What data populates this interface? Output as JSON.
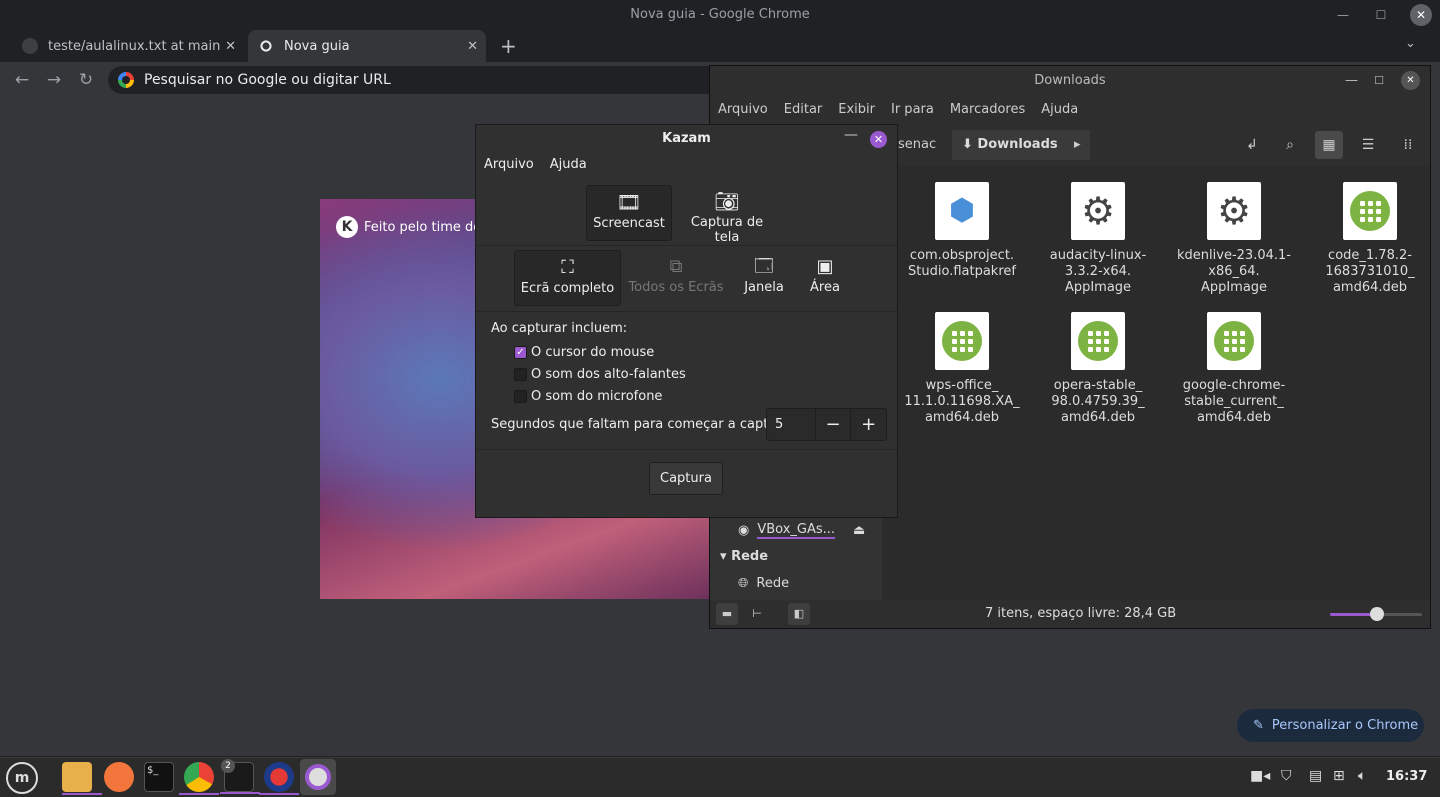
{
  "chrome": {
    "window_title": "Nova guia - Google Chrome",
    "tabs": [
      {
        "label": "teste/aulalinux.txt at main · ar",
        "icon": "github-icon"
      },
      {
        "label": "Nova guia",
        "icon": "chrome-icon"
      }
    ],
    "omnibox_placeholder": "Pesquisar no Google ou digitar URL",
    "kde_credit": "Feito pelo time do",
    "personalize_label": "Personalizar o Chrome"
  },
  "nemo": {
    "title": "Downloads",
    "menu": [
      "Arquivo",
      "Editar",
      "Exibir",
      "Ir para",
      "Marcadores",
      "Ajuda"
    ],
    "breadcrumb_prev": "senac",
    "breadcrumb_current": "Downloads",
    "files": [
      {
        "name": "com.obsproject.\nStudio.flatpakref",
        "icon": "flatpak-icon"
      },
      {
        "name": "audacity-linux-\n3.3.2-x64.\nAppImage",
        "icon": "gear-icon"
      },
      {
        "name": "kdenlive-23.04.1-\nx86_64.\nAppImage",
        "icon": "gear-icon"
      },
      {
        "name": "code_1.78.2-\n1683731010_\namd64.deb",
        "icon": "deb-icon"
      },
      {
        "name": "wps-office_\n11.1.0.11698.XA_\namd64.deb",
        "icon": "deb-icon"
      },
      {
        "name": "opera-stable_\n98.0.4759.39_\namd64.deb",
        "icon": "deb-icon"
      },
      {
        "name": "google-chrome-\nstable_current_\namd64.deb",
        "icon": "deb-icon"
      }
    ],
    "sidebar": {
      "device": "VBox_GAs...",
      "network_header": "Rede",
      "network_item": "Rede"
    },
    "status": "7 itens, espaço livre: 28,4 GB",
    "zoom_level": 0.5
  },
  "kazam": {
    "title": "Kazam",
    "menu": [
      "Arquivo",
      "Ajuda"
    ],
    "modes": [
      "Screencast",
      "Captura de tela"
    ],
    "sources": [
      "Ecrã completo",
      "Todos os Ecrãs",
      "Janela",
      "Área"
    ],
    "include_label": "Ao capturar incluem:",
    "options": [
      {
        "label": "O cursor do mouse",
        "checked": true
      },
      {
        "label": "O som dos alto-falantes",
        "checked": false
      },
      {
        "label": "O som do microfone",
        "checked": false
      }
    ],
    "countdown_label": "Segundos que faltam para começar a captura",
    "countdown_value": "5",
    "capture_button": "Captura"
  },
  "taskbar": {
    "clock": "16:37",
    "badge": "2",
    "accent": "#9b59d0"
  }
}
